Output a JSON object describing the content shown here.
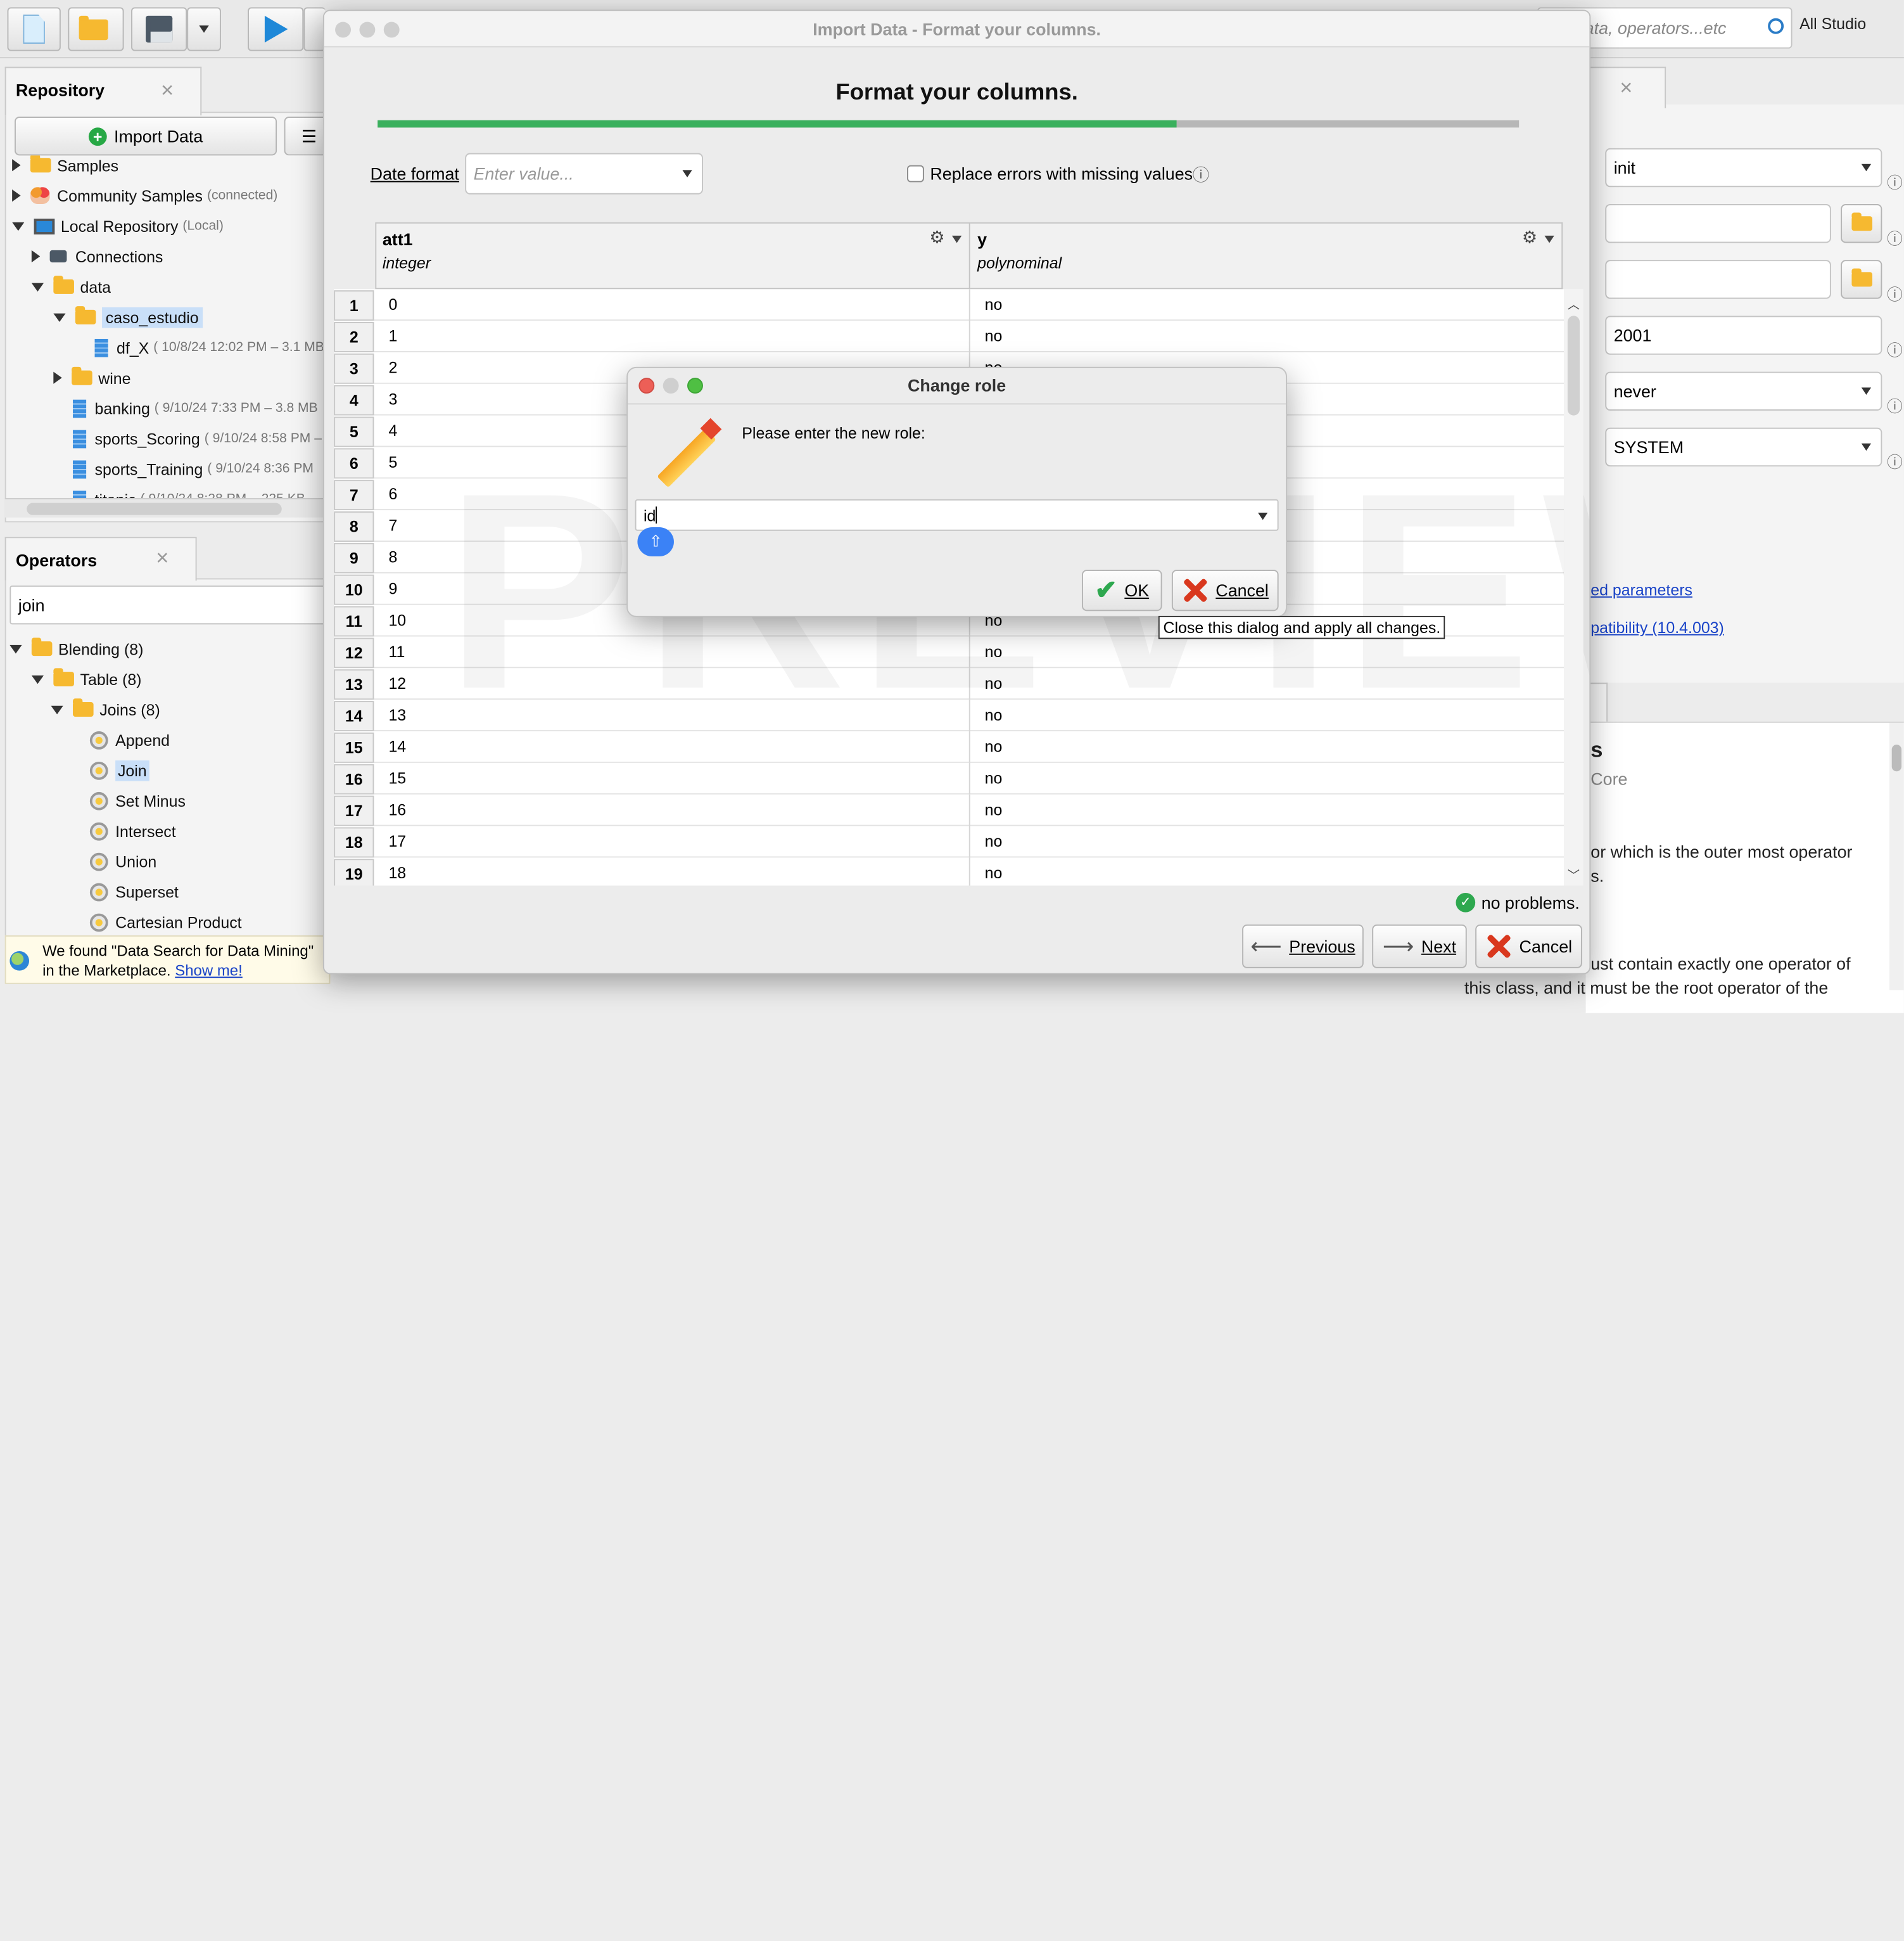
{
  "toolbar": {
    "search_placeholder": "data, operators...etc",
    "search_visible": "ata, operators...etc",
    "scope": "All Studio"
  },
  "repository": {
    "title": "Repository",
    "import_label": "Import Data",
    "items": [
      {
        "label": "Samples",
        "meta": ""
      },
      {
        "label": "Community Samples",
        "meta": "(connected)"
      },
      {
        "label": "Local Repository",
        "meta": "(Local)"
      },
      {
        "label": "Connections",
        "meta": ""
      },
      {
        "label": "data",
        "meta": ""
      },
      {
        "label": "caso_estudio",
        "meta": ""
      },
      {
        "label": "df_X",
        "meta": "( 10/8/24 12:02 PM – 3.1 MB"
      },
      {
        "label": "wine",
        "meta": ""
      },
      {
        "label": "banking",
        "meta": "( 9/10/24 7:33 PM – 3.8 MB"
      },
      {
        "label": "sports_Scoring",
        "meta": "( 9/10/24 8:58 PM –"
      },
      {
        "label": "sports_Training",
        "meta": "( 9/10/24 8:36 PM"
      },
      {
        "label": "titanic",
        "meta": "( 9/10/24 8:28 PM – 225 KB"
      }
    ]
  },
  "operators": {
    "title": "Operators",
    "search_value": "join",
    "items": [
      {
        "label": "Blending (8)"
      },
      {
        "label": "Table (8)"
      },
      {
        "label": "Joins (8)"
      },
      {
        "label": "Append"
      },
      {
        "label": "Join"
      },
      {
        "label": "Set Minus"
      },
      {
        "label": "Intersect"
      },
      {
        "label": "Union"
      },
      {
        "label": "Superset"
      },
      {
        "label": "Cartesian Product"
      }
    ],
    "marketplace_text_1": "We found \"Data Search for Data Mining\"",
    "marketplace_text_2": "in the Marketplace.",
    "marketplace_link": "Show me!"
  },
  "right_panel": {
    "fields": [
      "init",
      "",
      "",
      "2001",
      "never",
      "SYSTEM"
    ],
    "link1": "ed parameters",
    "link2": "patibility (10.4.003)",
    "heading": "s",
    "subheading": "Core",
    "desc1": "or which is the outer most operator",
    "desc2": "s.",
    "desc3": "ust contain exactly one operator of",
    "desc4": "this class, and it must be the root operator of the"
  },
  "import_dialog": {
    "window_title": "Import Data - Format your columns.",
    "heading": "Format your columns.",
    "progress_fraction": 0.7,
    "date_format_label": "Date format",
    "date_format_placeholder": "Enter value...",
    "replace_errors_label": "Replace errors with missing values",
    "columns": [
      {
        "name": "att1",
        "type": "integer"
      },
      {
        "name": "y",
        "type": "polynominal"
      }
    ],
    "rows": [
      {
        "n": "1",
        "a": "0",
        "b": "no"
      },
      {
        "n": "2",
        "a": "1",
        "b": "no"
      },
      {
        "n": "3",
        "a": "2",
        "b": "no"
      },
      {
        "n": "4",
        "a": "3",
        "b": ""
      },
      {
        "n": "5",
        "a": "4",
        "b": ""
      },
      {
        "n": "6",
        "a": "5",
        "b": ""
      },
      {
        "n": "7",
        "a": "6",
        "b": ""
      },
      {
        "n": "8",
        "a": "7",
        "b": ""
      },
      {
        "n": "9",
        "a": "8",
        "b": ""
      },
      {
        "n": "10",
        "a": "9",
        "b": ""
      },
      {
        "n": "11",
        "a": "10",
        "b": "no"
      },
      {
        "n": "12",
        "a": "11",
        "b": "no"
      },
      {
        "n": "13",
        "a": "12",
        "b": "no"
      },
      {
        "n": "14",
        "a": "13",
        "b": "no"
      },
      {
        "n": "15",
        "a": "14",
        "b": "no"
      },
      {
        "n": "16",
        "a": "15",
        "b": "no"
      },
      {
        "n": "17",
        "a": "16",
        "b": "no"
      },
      {
        "n": "18",
        "a": "17",
        "b": "no"
      },
      {
        "n": "19",
        "a": "18",
        "b": "no"
      }
    ],
    "status": "no problems.",
    "previous": "Previous",
    "next": "Next",
    "cancel": "Cancel",
    "watermark": "PREVIEW"
  },
  "change_role": {
    "title": "Change role",
    "prompt": "Please enter the new role:",
    "value": "id",
    "ok": "OK",
    "cancel": "Cancel",
    "tooltip": "Close this dialog and apply all changes."
  }
}
